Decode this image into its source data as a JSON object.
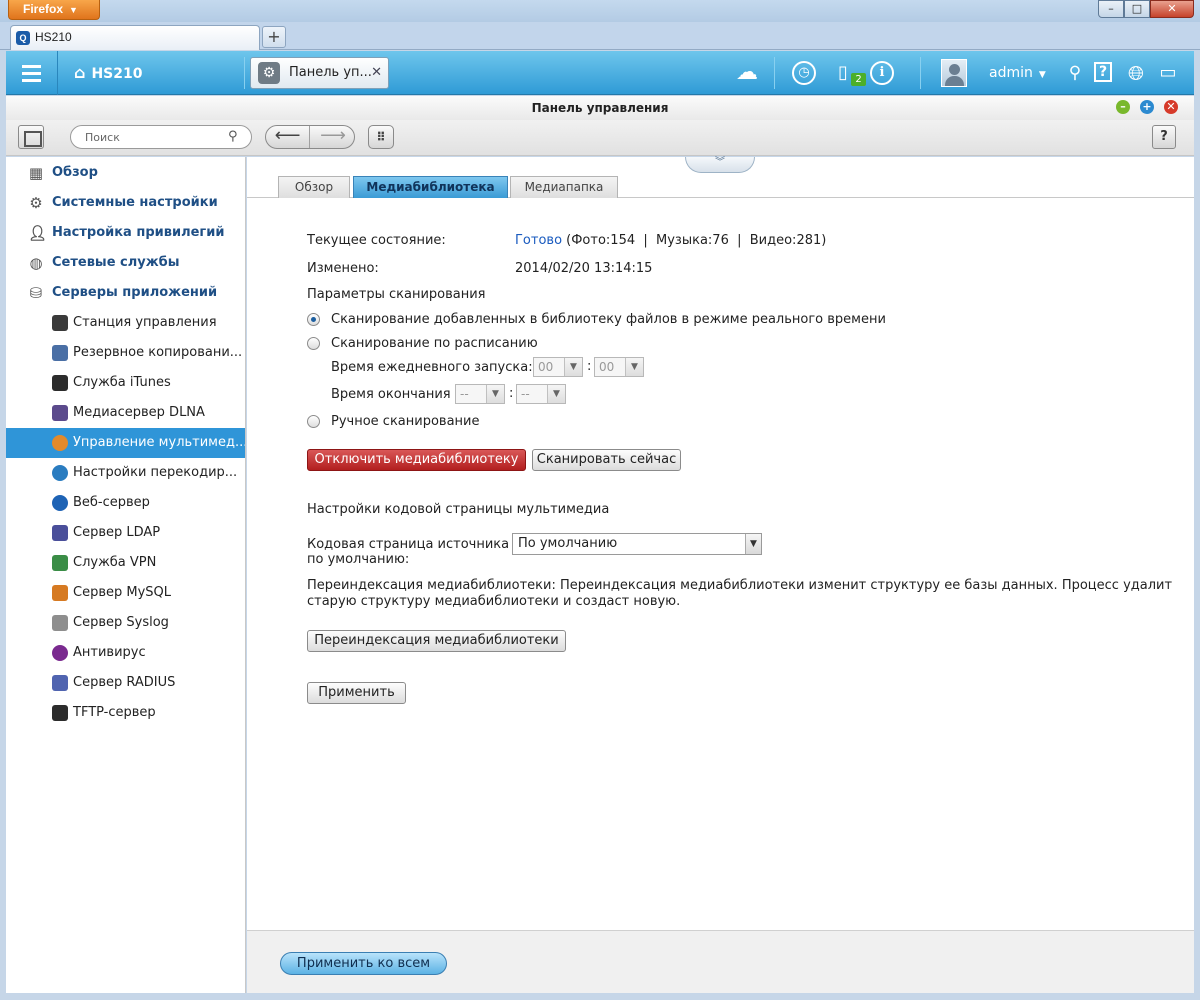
{
  "browser": {
    "menu_button": "Firefox",
    "tab_title": "HS210",
    "new_tab": "+",
    "window_controls": {
      "minimize": "–",
      "maximize": "□",
      "close": "✕"
    }
  },
  "topbar": {
    "host": "HS210",
    "app_tab_label": "Панель уп...",
    "notification_badge": "2",
    "user": "admin",
    "icons": [
      "menu-icon",
      "home-icon",
      "cloud-icon",
      "clock-icon",
      "device-icon",
      "info-icon",
      "avatar",
      "search-icon",
      "help-icon",
      "globe-icon",
      "monitor-icon"
    ]
  },
  "panel": {
    "title": "Панель управления",
    "search_placeholder": "Поиск",
    "help": "?"
  },
  "sidebar": {
    "sections": [
      {
        "label": "Обзор",
        "icon": "grid-icon"
      },
      {
        "label": "Системные настройки",
        "icon": "gear-icon"
      },
      {
        "label": "Настройка привилегий",
        "icon": "user-icon"
      },
      {
        "label": "Сетевые службы",
        "icon": "network-icon"
      },
      {
        "label": "Серверы приложений",
        "icon": "server-icon"
      }
    ],
    "items": [
      {
        "label": "Станция управления",
        "icon": "station-icon",
        "color": "#3a3a3a"
      },
      {
        "label": "Резервное копировани...",
        "icon": "backup-icon",
        "color": "#4a6fa5"
      },
      {
        "label": "Служба iTunes",
        "icon": "itunes-icon",
        "color": "#2c2c2c"
      },
      {
        "label": "Медиасервер DLNA",
        "icon": "dlna-icon",
        "color": "#5b4a8c"
      },
      {
        "label": "Управление мультимед...",
        "icon": "multimedia-icon",
        "color": "#e38a2b",
        "selected": true
      },
      {
        "label": "Настройки перекодир...",
        "icon": "transcode-icon",
        "color": "#2a7cc0"
      },
      {
        "label": "Веб-сервер",
        "icon": "web-icon",
        "color": "#1e63b5"
      },
      {
        "label": "Сервер LDAP",
        "icon": "ldap-icon",
        "color": "#4a4f9a"
      },
      {
        "label": "Служба VPN",
        "icon": "vpn-icon",
        "color": "#3a8d46"
      },
      {
        "label": "Сервер MySQL",
        "icon": "mysql-icon",
        "color": "#d67a22"
      },
      {
        "label": "Сервер Syslog",
        "icon": "syslog-icon",
        "color": "#8e8e8e"
      },
      {
        "label": "Антивирус",
        "icon": "antivirus-icon",
        "color": "#7a2a8f"
      },
      {
        "label": "Сервер RADIUS",
        "icon": "radius-icon",
        "color": "#5064b0"
      },
      {
        "label": "TFTP-сервер",
        "icon": "tftp-icon",
        "color": "#2c2c2c"
      }
    ]
  },
  "tabs": [
    "Обзор",
    "Медиабиблиотека",
    "Медиапапка"
  ],
  "active_tab": 1,
  "status": {
    "current_label": "Текущее состояние:",
    "current_value": "Готово",
    "current_counts": "(Фото:154  |  Музыка:76  |  Видео:281)",
    "changed_label": "Изменено:",
    "changed_value": "2014/02/20 13:14:15"
  },
  "scan": {
    "heading": "Параметры сканирования",
    "options": [
      "Сканирование добавленных в библиотеку файлов в режиме реального времени",
      "Сканирование по расписанию",
      "Ручное сканирование"
    ],
    "selected_option": 0,
    "daily_start_label": "Время ежедневного запуска:",
    "daily_start_hour": "00",
    "daily_start_minute": "00",
    "end_label": "Время окончания",
    "end_hour": "--",
    "end_minute": "--",
    "colon": ":"
  },
  "buttons": {
    "disable": "Отключить медиабиблиотеку",
    "scan_now": "Сканировать сейчас",
    "reindex": "Переиндексация медиабиблиотеки",
    "apply": "Применить",
    "apply_all": "Применить ко всем"
  },
  "codepage": {
    "heading": "Настройки кодовой страницы мультимедиа",
    "label_line1": "Кодовая страница источника",
    "label_line2": "по умолчанию:",
    "value": "По умолчанию"
  },
  "reindex": {
    "text_line1": "Переиндексация медиабиблиотеки: Переиндексация медиабиблиотеки изменит структуру ее базы данных. Процесс удалит",
    "text_line2": "старую структуру медиабиблиотеки и создаст новую."
  },
  "colors": {
    "accent": "#2f95d8",
    "link": "#1a5bbf",
    "danger": "#c23333"
  }
}
